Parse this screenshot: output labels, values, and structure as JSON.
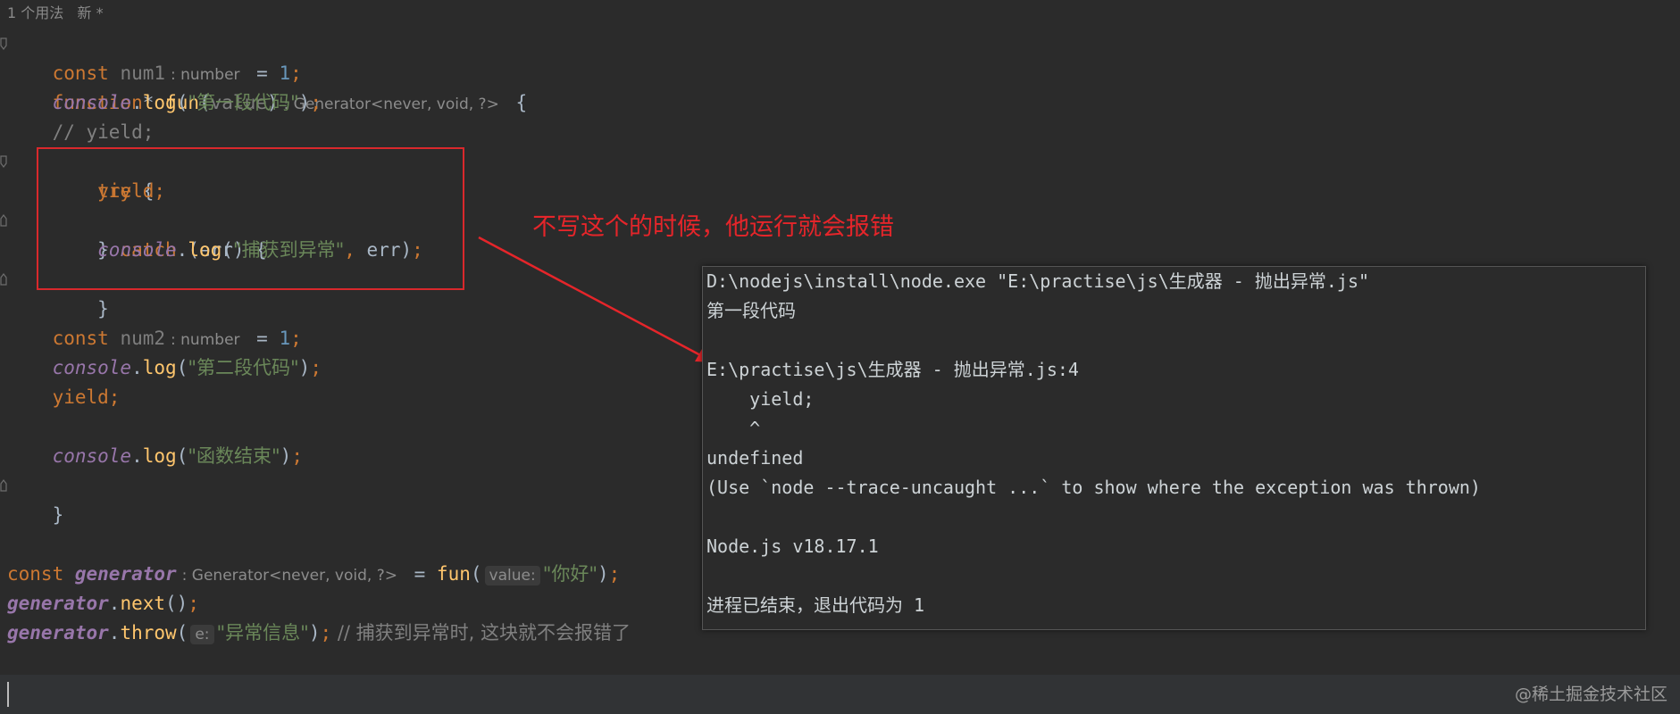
{
  "header": {
    "usage": "1 个用法   新 *"
  },
  "code": {
    "l1": {
      "kw": "function",
      "star": "*",
      "fn": "fun",
      "open": "(",
      "param": "value",
      "close": ")",
      "hint": ": Generator<never, void, ?>",
      "brace": " {"
    },
    "l2": {
      "kw": "const",
      "var": "num1",
      "hint": ": number",
      "eq": " = ",
      "num": "1",
      "semi": ";"
    },
    "l3": {
      "obj": "console",
      "dot": ".",
      "method": "log",
      "open": "(",
      "str": "\"第一段代码\"",
      "close": ")",
      "semi": ";"
    },
    "l4": {
      "comment": "// yield;"
    },
    "l5": {
      "kw": "try",
      "brace": " {"
    },
    "l6": {
      "kw": "yield",
      "semi": ";"
    },
    "l7": {
      "b1": "} ",
      "kw": "catch",
      "rest": " (err) {"
    },
    "l8": {
      "obj": "console",
      "dot": ".",
      "method": "log",
      "open": "(",
      "str": "\"捕获到异常\"",
      "comma": ",",
      "arg": " err",
      "close": ")",
      "semi": ";"
    },
    "l9": {
      "brace": "}"
    },
    "l11": {
      "kw": "const",
      "var": "num2",
      "hint": ": number",
      "eq": " = ",
      "num": "1",
      "semi": ";"
    },
    "l12": {
      "obj": "console",
      "dot": ".",
      "method": "log",
      "open": "(",
      "str": "\"第二段代码\"",
      "close": ")",
      "semi": ";"
    },
    "l13": {
      "kw": "yield",
      "semi": ";"
    },
    "l15": {
      "obj": "console",
      "dot": ".",
      "method": "log",
      "open": "(",
      "str": "\"函数结束\"",
      "close": ")",
      "semi": ";"
    },
    "l16": {
      "brace": "}"
    },
    "l19": {
      "kw": "const",
      "var": "generator",
      "hint": ": Generator<never, void, ?>",
      "eq": " = ",
      "fn": "fun",
      "open": "(",
      "param_hint": "value:",
      "str": "\"你好\"",
      "close": ")",
      "semi": ";"
    },
    "l20": {
      "obj": "generator",
      "dot": ".",
      "method": "next",
      "call": "()",
      "semi": ";"
    },
    "l21": {
      "obj": "generator",
      "dot": ".",
      "method": "throw",
      "open": "(",
      "param_hint": "e:",
      "str": "\"异常信息\"",
      "close": ")",
      "semi": ";",
      "comment": " // 捕获到异常时, 这块就不会报错了"
    }
  },
  "annotation": {
    "text": "不写这个的时候，他运行就会报错"
  },
  "console": {
    "lines": [
      "D:\\nodejs\\install\\node.exe \"E:\\practise\\js\\生成器 - 抛出异常.js\"",
      "第一段代码",
      "",
      "E:\\practise\\js\\生成器 - 抛出异常.js:4",
      "    yield;",
      "    ^",
      "undefined",
      "(Use `node --trace-uncaught ...` to show where the exception was thrown)",
      "",
      "Node.js v18.17.1",
      "",
      "进程已结束，退出代码为 1"
    ]
  },
  "watermark": {
    "text": "@稀土掘金技术社区"
  },
  "colors": {
    "accent_red": "#e5252a",
    "editor_bg": "#2b2b2b",
    "keyword": "#cc7832",
    "string": "#6a8759"
  }
}
